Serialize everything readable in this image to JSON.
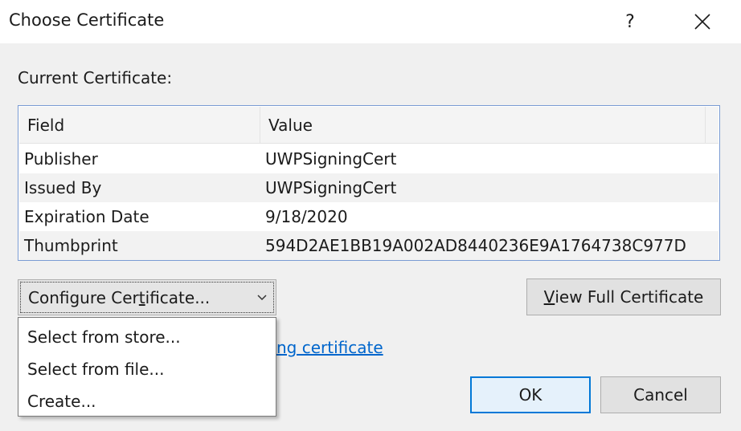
{
  "window": {
    "title": "Choose Certificate",
    "help_glyph": "?",
    "close_icon": "close-icon"
  },
  "current_label": "Current Certificate:",
  "grid": {
    "columns": [
      "Field",
      "Value"
    ],
    "rows": [
      {
        "field": "Publisher",
        "value": "UWPSigningCert"
      },
      {
        "field": "Issued By",
        "value": "UWPSigningCert"
      },
      {
        "field": "Expiration Date",
        "value": "9/18/2020"
      },
      {
        "field": "Thumbprint",
        "value": "594D2AE1BB19A002AD8440236E9A1764738C977D"
      }
    ]
  },
  "configure": {
    "label_pre": "Configure Cer",
    "label_accel": "t",
    "label_post": "ificate...",
    "options": [
      "Select from store...",
      "Select from file...",
      "Create..."
    ]
  },
  "link_text": "ng certificate",
  "buttons": {
    "view_accel": "V",
    "view_rest": "iew Full Certificate",
    "ok": "OK",
    "cancel": "Cancel"
  },
  "colors": {
    "accent": "#0078d7",
    "link": "#0066cc",
    "grid_border": "#7a9bd3"
  }
}
